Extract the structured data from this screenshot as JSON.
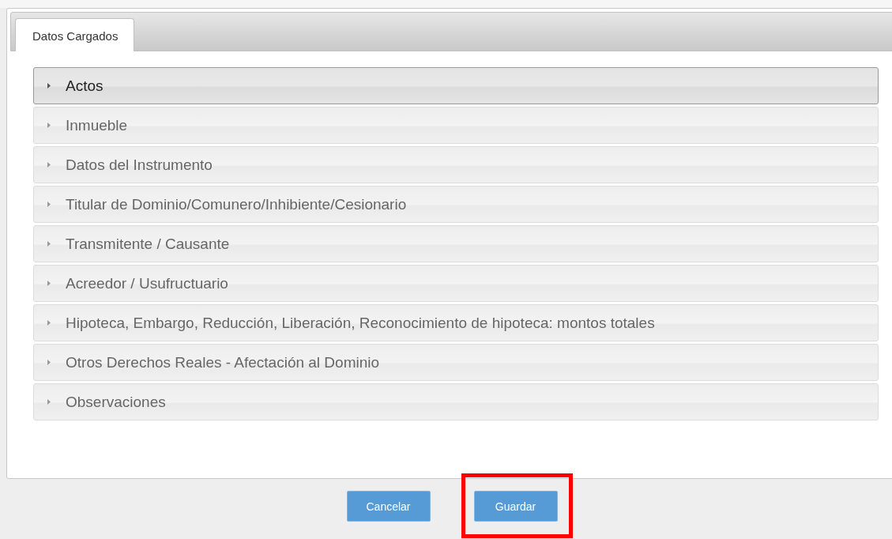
{
  "tabs": [
    {
      "label": "Datos Cargados",
      "selected": true
    }
  ],
  "sections": [
    {
      "label": "Actos",
      "selected": true
    },
    {
      "label": "Inmueble",
      "selected": false
    },
    {
      "label": "Datos del Instrumento",
      "selected": false
    },
    {
      "label": "Titular de Dominio/Comunero/Inhibiente/Cesionario",
      "selected": false
    },
    {
      "label": "Transmitente / Causante",
      "selected": false
    },
    {
      "label": "Acreedor / Usufructuario",
      "selected": false
    },
    {
      "label": "Hipoteca, Embargo, Reducción, Liberación, Reconocimiento de hipoteca: montos totales",
      "selected": false
    },
    {
      "label": "Otros Derechos Reales - Afectación al Dominio",
      "selected": false
    },
    {
      "label": "Observaciones",
      "selected": false
    }
  ],
  "buttons": [
    {
      "label": "Cancelar",
      "highlighted": false
    },
    {
      "label": "Guardar",
      "highlighted": true
    }
  ]
}
